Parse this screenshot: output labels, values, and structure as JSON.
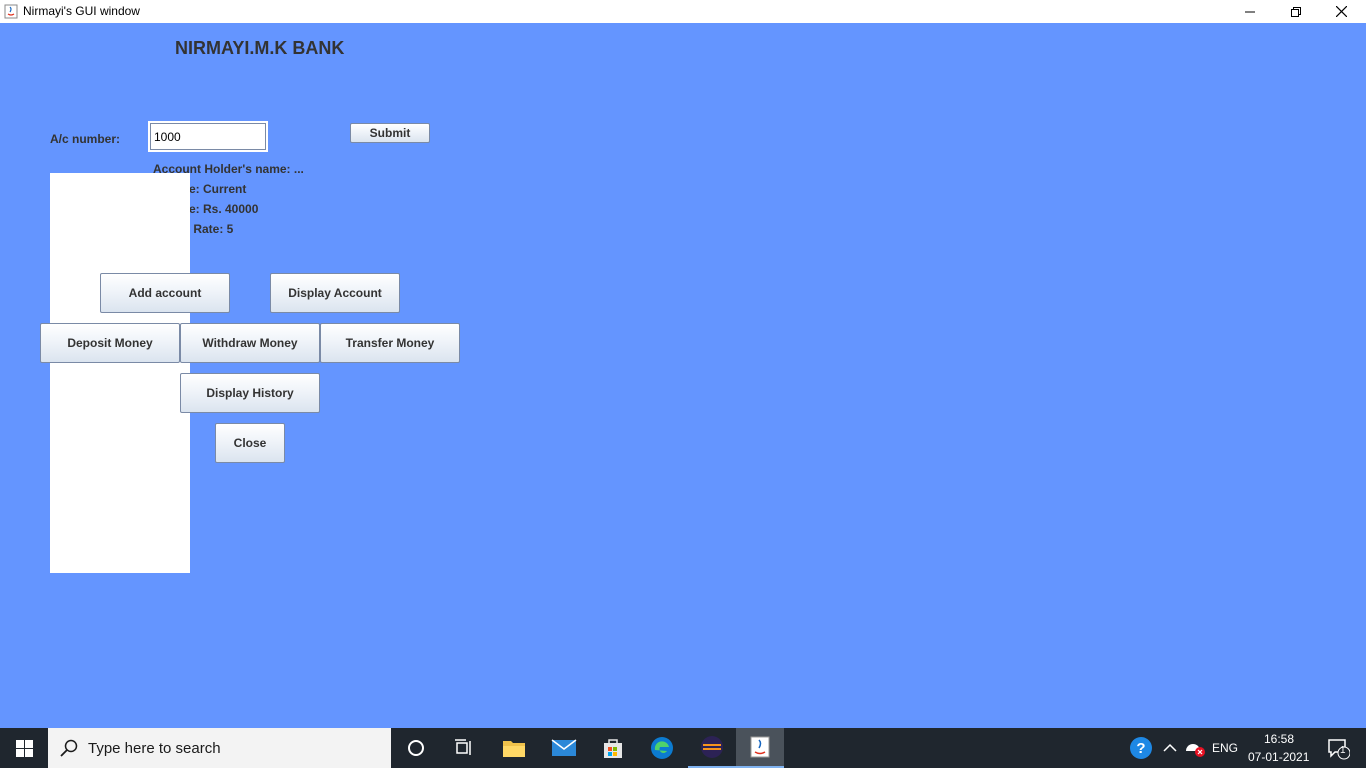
{
  "window": {
    "title": "Nirmayi's GUI window",
    "controls": {
      "minimize": "minimize",
      "maximize": "restore",
      "close": "close"
    }
  },
  "app": {
    "bank_title": "NIRMAYI.M.K BANK",
    "account_label": "A/c number:",
    "account_value": "1000",
    "submit_label": "Submit",
    "info": {
      "holder": "Account Holder's name: ...",
      "type": "e: Current",
      "balance": "e: Rs. 40000",
      "rate": "t Rate: 5"
    },
    "buttons": {
      "add_account": "Add account",
      "display_account": "Display Account",
      "deposit": "Deposit Money",
      "withdraw": "Withdraw Money",
      "transfer": "Transfer Money",
      "history": "Display History",
      "close": "Close"
    }
  },
  "taskbar": {
    "search_placeholder": "Type here to search",
    "language": "ENG",
    "time": "16:58",
    "date": "07-01-2021",
    "notification_count": "1"
  },
  "colors": {
    "window_bg": "#6495ff",
    "taskbar_bg": "#1f262e",
    "text": "#333333"
  }
}
